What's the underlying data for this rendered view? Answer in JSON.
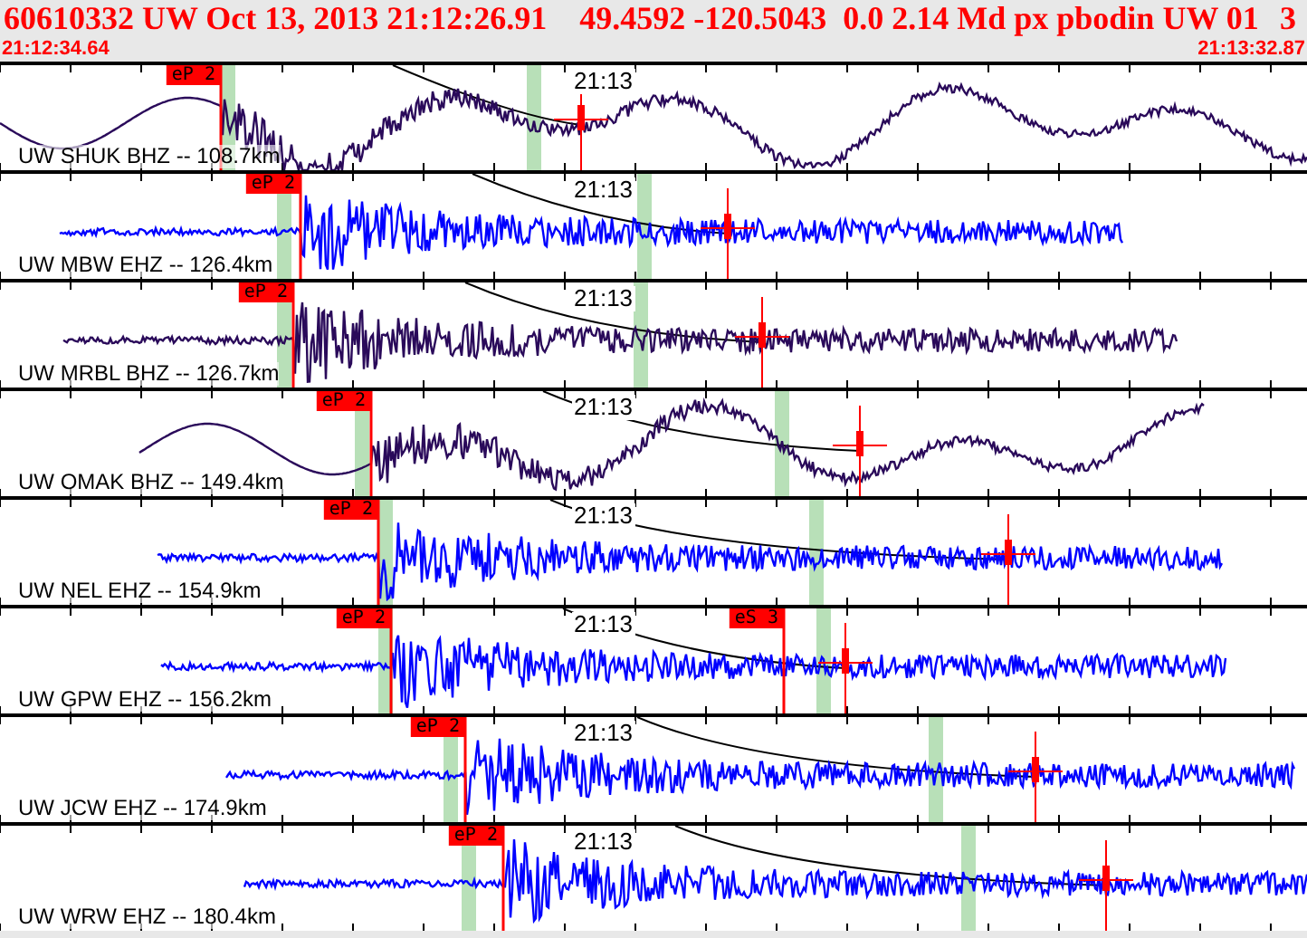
{
  "header": {
    "title": "60610332 UW Oct 13, 2013 21:12:26.91    49.4592 -120.5043  0.0 2.14 Md px pbodin UW 01",
    "page": "3",
    "start_time": "21:12:34.64",
    "end_time": "21:13:32.87"
  },
  "traces": [
    {
      "label": "UW SHUK BHZ -- 108.7km",
      "time_mark": "21:13",
      "color": "#2a0a5a",
      "kind": "long",
      "picks": [
        {
          "label": "eP 2"
        }
      ]
    },
    {
      "label": "UW MBW EHZ -- 126.4km",
      "time_mark": "21:13",
      "color": "#0000ff",
      "kind": "short",
      "picks": [
        {
          "label": "eP 2"
        }
      ]
    },
    {
      "label": "UW MRBL BHZ -- 126.7km",
      "time_mark": "21:13",
      "color": "#2a0a5a",
      "kind": "short",
      "picks": [
        {
          "label": "eP 2"
        }
      ]
    },
    {
      "label": "UW OMAK BHZ -- 149.4km",
      "time_mark": "21:13",
      "color": "#2a0a5a",
      "kind": "long",
      "picks": [
        {
          "label": "eP 2"
        }
      ]
    },
    {
      "label": "UW NEL EHZ -- 154.9km",
      "time_mark": "21:13",
      "color": "#0000ff",
      "kind": "short",
      "picks": [
        {
          "label": "eP 2"
        }
      ]
    },
    {
      "label": "UW GPW EHZ -- 156.2km",
      "time_mark": "21:13",
      "color": "#0000ff",
      "kind": "short",
      "picks": [
        {
          "label": "eP 2"
        },
        {
          "label": "eS 3"
        }
      ]
    },
    {
      "label": "UW JCW EHZ -- 174.9km",
      "time_mark": "21:13",
      "color": "#0000ff",
      "kind": "short",
      "picks": [
        {
          "label": "eP 2"
        }
      ]
    },
    {
      "label": "UW WRW EHZ -- 180.4km",
      "time_mark": "21:13",
      "color": "#0000ff",
      "kind": "short",
      "picks": [
        {
          "label": "eP 2"
        }
      ]
    }
  ]
}
